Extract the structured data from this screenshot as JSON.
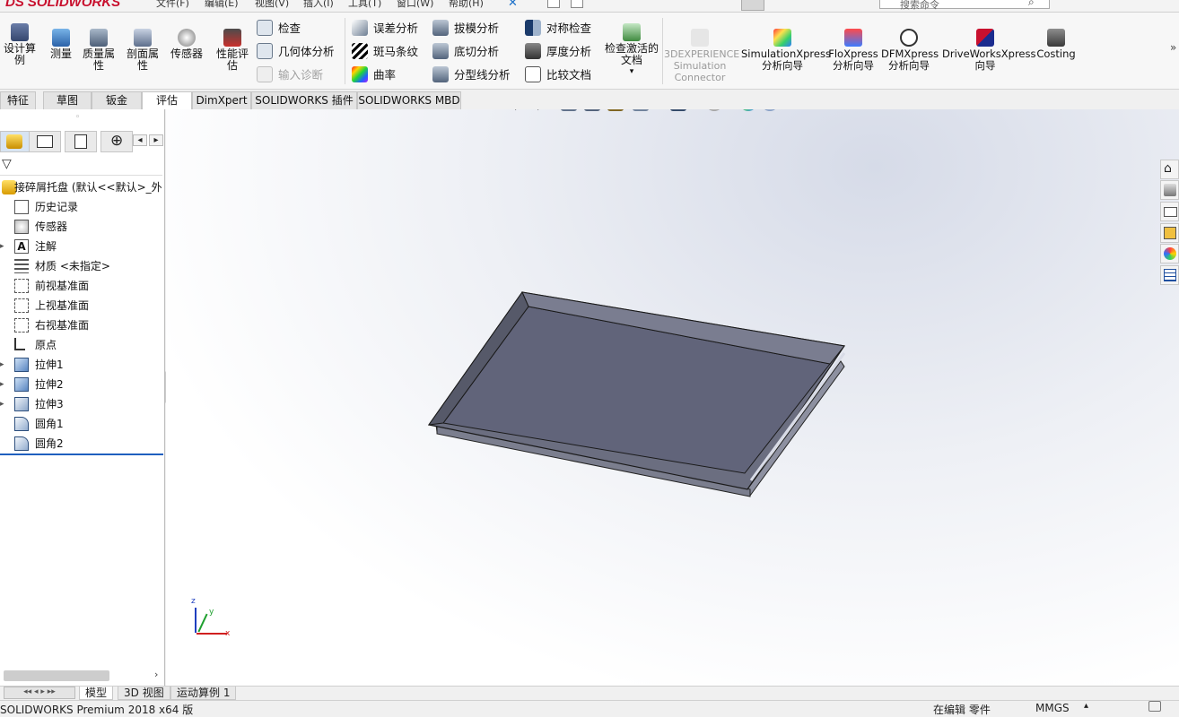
{
  "app": {
    "brand": "SOLIDWORKS",
    "brand_prefix": "DS"
  },
  "menu": [
    "文件(F)",
    "编辑(E)",
    "视图(V)",
    "插入(I)",
    "工具(T)",
    "窗口(W)",
    "帮助(H)"
  ],
  "search": {
    "placeholder": "搜索命令"
  },
  "toolbar": {
    "design_study": "设计算例",
    "measure": "测量",
    "mass_props": "质量属性",
    "section_props": "剖面属性",
    "sensor": "传感器",
    "perf_eval": "性能评估",
    "check": "检查",
    "geometry_analysis": "几何体分析",
    "import_diag": "输入诊断",
    "deviation": "误差分析",
    "zebra": "斑马条纹",
    "curvature": "曲率",
    "draft_analysis": "拔模分析",
    "undercut": "底切分析",
    "parting_line": "分型线分析",
    "symmetry": "对称检查",
    "thickness": "厚度分析",
    "compare_docs": "比较文档",
    "check_active": "检查激活的文档",
    "exp_connector": "3DEXPERIENCE Simulation Connector",
    "simxpress": "SimulationXpress 分析向导",
    "floxpress": "FloXpress 分析向导",
    "dfmxpress": "DFMXpress 分析向导",
    "driveworks": "DriveWorksXpress 向导",
    "costing": "Costing"
  },
  "tabs": [
    "特征",
    "草图",
    "钣金",
    "评估",
    "DimXpert",
    "SOLIDWORKS 插件",
    "SOLIDWORKS MBD"
  ],
  "active_tab": "评估",
  "tree": {
    "root": "接碎屑托盘  (默认<<默认>_外",
    "items": [
      "历史记录",
      "传感器",
      "注解",
      "材质 <未指定>",
      "前视基准面",
      "上视基准面",
      "右视基准面",
      "原点",
      "拉伸1",
      "拉伸2",
      "拉伸3",
      "圆角1",
      "圆角2"
    ]
  },
  "bottom_tabs": [
    "模型",
    "3D 视图",
    "运动算例 1"
  ],
  "active_bottom_tab": "模型",
  "status": {
    "product": "SOLIDWORKS Premium 2018 x64 版",
    "editing": "在编辑 零件",
    "units": "MMGS"
  },
  "triad": {
    "x": "x",
    "y": "y",
    "z": "z"
  },
  "colors": {
    "brand_red": "#c8102e",
    "part_fill": "#6b6e80",
    "accent_blue": "#1f5fbf"
  }
}
